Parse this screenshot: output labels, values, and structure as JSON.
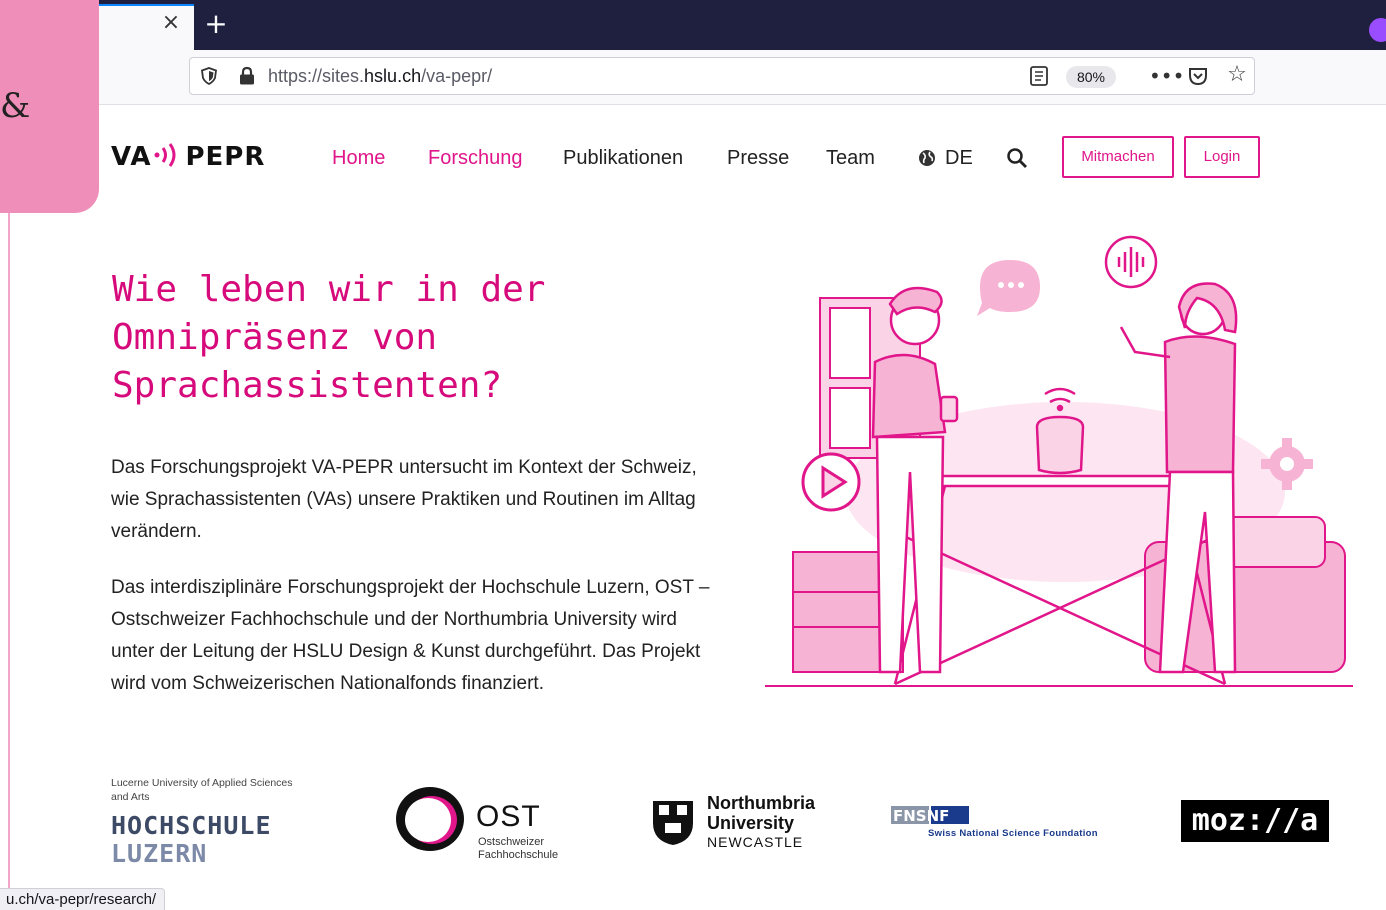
{
  "browser": {
    "tab_close": "×",
    "new_tab": "+",
    "url_prefix": "https://sites.",
    "url_domain": "hslu.ch",
    "url_path": "/va-pepr/",
    "zoom": "80%",
    "more": "•••",
    "star": "☆",
    "status_url": "u.ch/va-pepr/research/"
  },
  "side_overlay": {
    "glyph": "&"
  },
  "site": {
    "logo_left": "VA",
    "logo_right": "PEPR",
    "nav": [
      {
        "label": "Home"
      },
      {
        "label": "Forschung"
      },
      {
        "label": "Publikationen"
      },
      {
        "label": "Presse"
      },
      {
        "label": "Team"
      },
      {
        "label": "DE"
      }
    ],
    "btn_mitmachen": "Mitmachen",
    "btn_login": "Login"
  },
  "hero": {
    "title": "Wie leben wir in der Omnipräsenz von Sprachassistenten?",
    "para1": "Das Forschungsprojekt VA-PEPR untersucht im Kontext der Schweiz, wie Sprachassistenten (VAs) unsere Praktiken und Routinen im Alltag verändern.",
    "para2": "Das interdisziplinäre Forschungsprojekt der Hochschule Luzern, OST – Ostschweizer Fachhochschule und der Northumbria University wird unter der Leitung der HSLU Design & Kunst durchgeführt.  Das Projekt wird vom Schweizerischen Nationalfonds finanziert."
  },
  "partners": {
    "hslu_small": "Lucerne University of Applied Sciences and Arts",
    "hslu_line1": "HOCHSCHULE",
    "hslu_line2": "LUZERN",
    "ost_big": "OST",
    "ost_small1": "Ostschweizer",
    "ost_small2": "Fachhochschule",
    "nu_line1": "Northumbria",
    "nu_line2": "University",
    "nu_city": "NEWCASTLE",
    "snf_logo": "FNSNF",
    "snf_text": "Swiss National Science Foundation",
    "mozilla": "moz://a"
  },
  "colors": {
    "brand_pink": "#e0168a",
    "browser_dark": "#1f2040",
    "side_pink": "#ef8fb9"
  }
}
